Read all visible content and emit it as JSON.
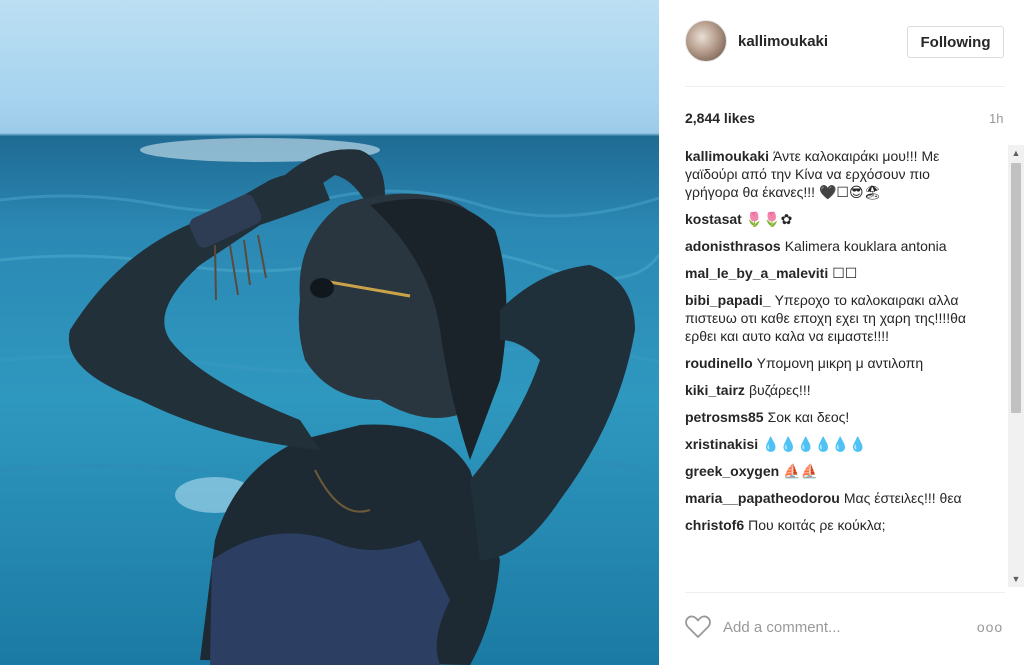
{
  "post": {
    "username": "kallimoukaki",
    "follow_label": "Following",
    "likes": "2,844 likes",
    "time": "1h"
  },
  "comments": [
    {
      "author": "kallimoukaki",
      "text": "Άντε καλοκαιράκι μου!!! Με γαϊδούρι από την Κίνα να ερχόσουν πιο γρήγορα θα έκανες!!! 🖤☐😎🏖"
    },
    {
      "author": "kostasat",
      "text": "🌷🌷✿"
    },
    {
      "author": "adonisthrasos",
      "text": "Kalimera kouklara antonia"
    },
    {
      "author": "mal_le_by_a_maleviti",
      "text": "☐☐"
    },
    {
      "author": "bibi_papadi_",
      "text": "Υπεροχο το καλοκαιρακι αλλα πιστευω οτι καθε εποχη εχει τη χαρη της!!!!θα ερθει και αυτο καλα να ειμαστε!!!!"
    },
    {
      "author": "roudinello",
      "text": "Υπομονη μικρη μ αντιλοπη"
    },
    {
      "author": "kiki_tairz",
      "text": "βυζάρες!!!"
    },
    {
      "author": "petrosms85",
      "text": "Σοκ και δεος!"
    },
    {
      "author": "xristinakisi",
      "text": "💧💧💧💧💧💧"
    },
    {
      "author": "greek_oxygen",
      "text": "⛵⛵"
    },
    {
      "author": "maria__papatheodorou",
      "text": "Μας έστειλες!!! θεα"
    },
    {
      "author": "christof6",
      "text": "Που κοιτάς ρε κούκλα;"
    }
  ],
  "footer": {
    "placeholder": "Add a comment...",
    "more_label": "ooo"
  },
  "icons": {
    "heart": "heart-icon",
    "more": "more-options-icon",
    "scroll_up": "scroll-up-arrow-icon",
    "scroll_down": "scroll-down-arrow-icon"
  },
  "colors": {
    "text": "#262626",
    "muted": "#999999",
    "border": "#dbdbdb"
  }
}
